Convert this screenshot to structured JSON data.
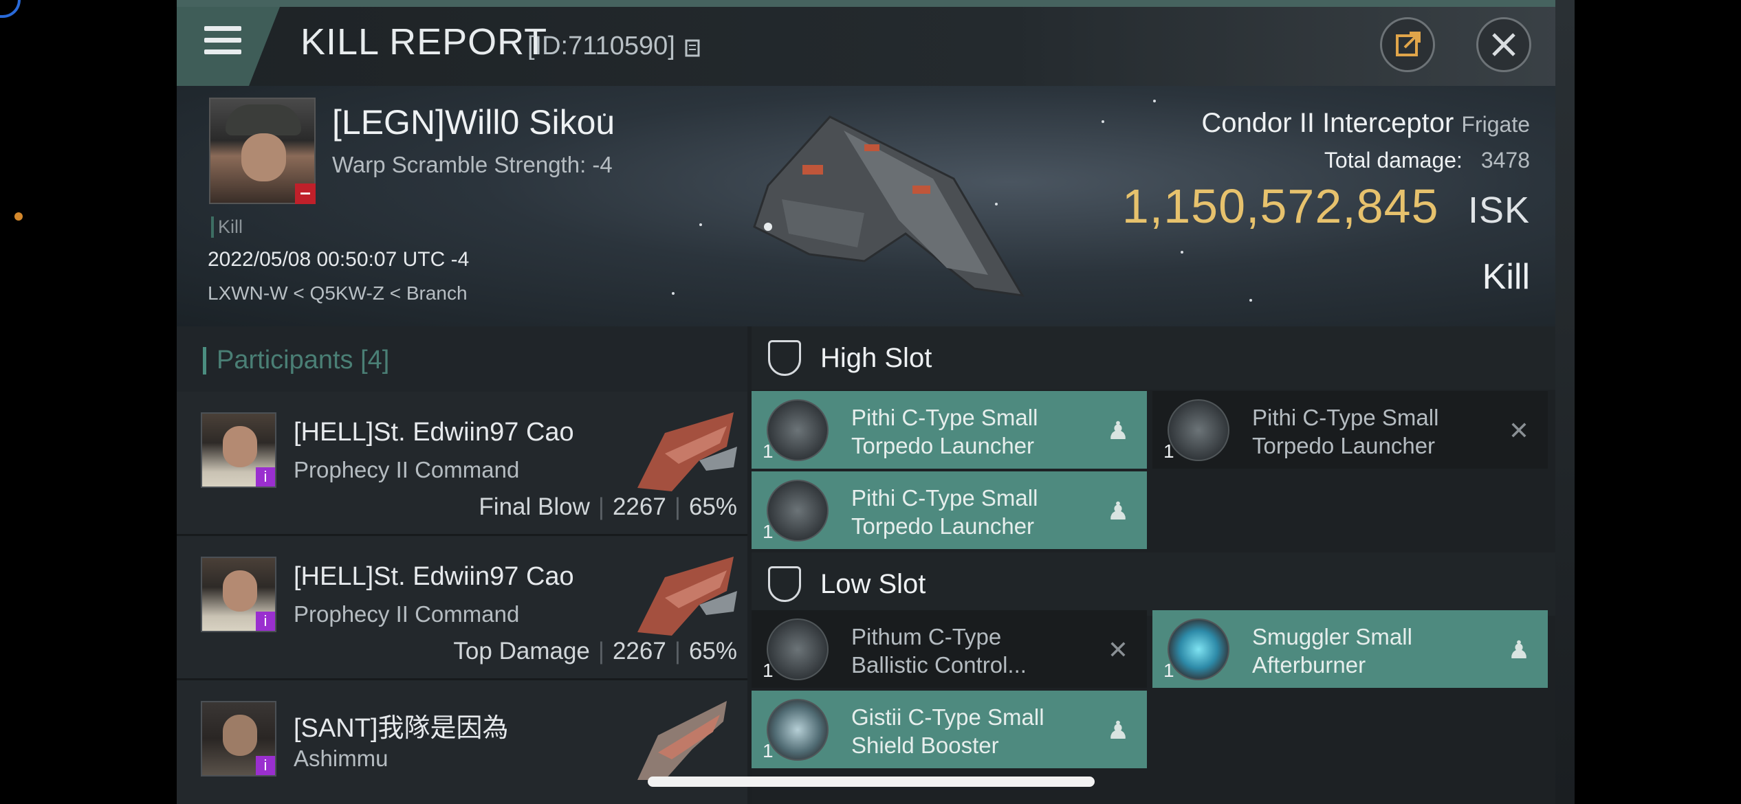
{
  "window": {
    "title": "KILL REPORT",
    "report_id": "[ID:7110590]"
  },
  "victim": {
    "name": "[LEGN]Will0 Sikou",
    "warp_scramble": "Warp Scramble Strength: -4",
    "result_tag": "Kill",
    "timestamp": "2022/05/08 00:50:07 UTC -4",
    "location": "LXWN-W < Q5KW-Z < Branch",
    "ship_name": "Condor II Interceptor",
    "ship_class": "Frigate",
    "total_damage_label": "Total damage:",
    "total_damage": "3478",
    "isk_value": "1,150,572,845",
    "isk_unit": "ISK",
    "kill_label": "Kill"
  },
  "participants": {
    "title": "Participants",
    "count": "[4]",
    "rows": [
      {
        "name": "[HELL]St. Edwiin97 Cao",
        "ship": "Prophecy II Command",
        "role": "Final Blow",
        "damage": "2267",
        "percent": "65%"
      },
      {
        "name": "[HELL]St. Edwiin97 Cao",
        "ship": "Prophecy II Command",
        "role": "Top Damage",
        "damage": "2267",
        "percent": "65%"
      },
      {
        "name": "[SANT]我隊是因為",
        "ship": "Ashimmu",
        "role": "",
        "damage": "",
        "percent": ""
      }
    ]
  },
  "fittings": {
    "high_slot": {
      "label": "High Slot",
      "modules": [
        {
          "name": "Pithi C-Type Small Torpedo Launcher",
          "qty": "1",
          "status": "fitted"
        },
        {
          "name": "Pithi C-Type Small Torpedo Launcher",
          "qty": "1",
          "status": "dropped"
        },
        {
          "name": "Pithi C-Type Small Torpedo Launcher",
          "qty": "1",
          "status": "fitted"
        }
      ]
    },
    "low_slot": {
      "label": "Low Slot",
      "modules": [
        {
          "name": "Pithum C-Type Ballistic Control...",
          "qty": "1",
          "status": "dropped"
        },
        {
          "name": "Smuggler Small Afterburner",
          "qty": "1",
          "status": "fitted"
        },
        {
          "name": "Gistii C-Type Small Shield Booster",
          "qty": "1",
          "status": "fitted"
        }
      ]
    }
  },
  "colors": {
    "accent_teal": "#4e8a7f",
    "isk_gold": "#e7c26d",
    "kill_badge_red": "#c0202a",
    "corp_badge_purple": "#9a2fcf"
  },
  "icons": {
    "menu": "hamburger-icon",
    "share": "share-icon",
    "close": "close-icon",
    "slot": "shield-slot-icon",
    "fitted_status": "person-icon",
    "dropped_status": "x-icon"
  }
}
